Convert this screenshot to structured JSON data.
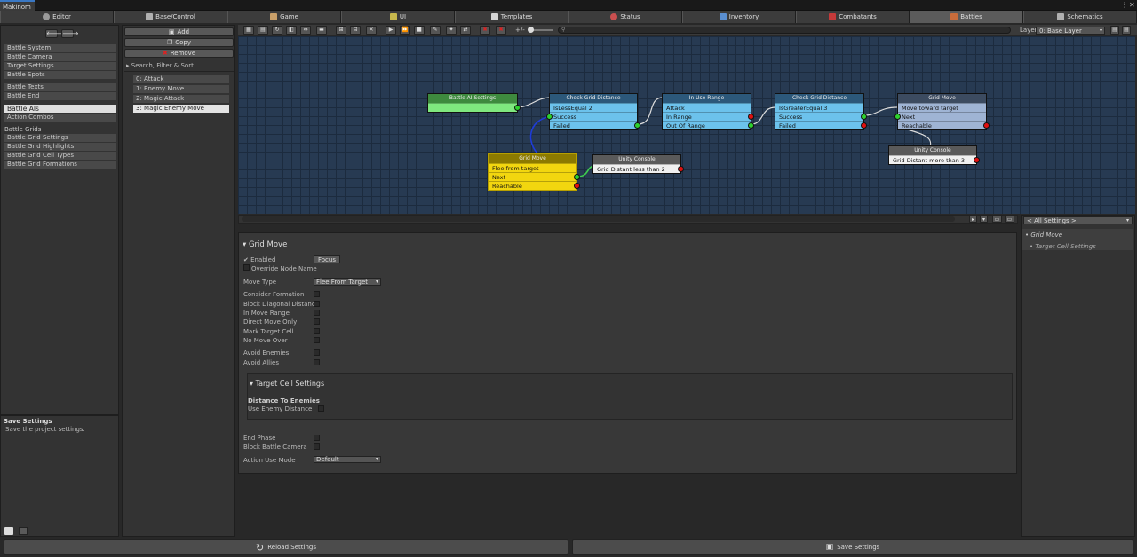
{
  "window": {
    "title": "Makinom"
  },
  "tabs": [
    {
      "label": "Editor",
      "icon": "gear-icon",
      "color": "#9a9a9a"
    },
    {
      "label": "Base/Control",
      "icon": "gamepad-icon",
      "color": "#b0b0b0"
    },
    {
      "label": "Game",
      "icon": "cube-icon",
      "color": "#c9a06a"
    },
    {
      "label": "UI",
      "icon": "ui-icon",
      "color": "#c7b84d"
    },
    {
      "label": "Templates",
      "icon": "document-icon",
      "color": "#d5d5d5"
    },
    {
      "label": "Status",
      "icon": "heart-icon",
      "color": "#c94f4f"
    },
    {
      "label": "Inventory",
      "icon": "potion-icon",
      "color": "#5a8fd1"
    },
    {
      "label": "Combatants",
      "icon": "character-icon",
      "color": "#c53a3a"
    },
    {
      "label": "Battles",
      "icon": "swords-icon",
      "color": "#c96c3b"
    },
    {
      "label": "Schematics",
      "icon": "node-icon",
      "color": "#b0b0b0"
    }
  ],
  "sidebar": {
    "items": [
      {
        "label": "Battle System"
      },
      {
        "label": "Battle Camera"
      },
      {
        "label": "Target Settings"
      },
      {
        "label": "Battle Spots"
      },
      {
        "label": "Battle Texts"
      },
      {
        "label": "Battle End"
      },
      {
        "label": "Battle AIs"
      },
      {
        "label": "Action Combos"
      },
      {
        "label": "Battle Grids"
      },
      {
        "label": "Battle Grid Settings"
      },
      {
        "label": "Battle Grid Highlights"
      },
      {
        "label": "Battle Grid Cell Types"
      },
      {
        "label": "Battle Grid Formations"
      }
    ],
    "help_title": "Save Settings",
    "help_text": "Save the project settings."
  },
  "list_panel": {
    "add": "Add",
    "copy": "Copy",
    "remove": "Remove",
    "search": "Search, Filter & Sort",
    "items": [
      "0: Attack",
      "1: Enemy Move",
      "2: Magic Attack",
      "3: Magic Enemy Move"
    ]
  },
  "toolbar": {
    "zoom": "+/-",
    "layer_label": "Layer",
    "layer_value": "0: Base Layer"
  },
  "nodes": {
    "n1": {
      "title": "Battle AI Settings"
    },
    "n2": {
      "title": "Check Grid Distance",
      "rows": [
        "IsLessEqual 2",
        "Success",
        "Failed"
      ]
    },
    "n3": {
      "title": "In Use Range",
      "rows": [
        "Attack",
        "In Range",
        "Out Of Range"
      ]
    },
    "n4": {
      "title": "Check Grid Distance",
      "rows": [
        "IsGreaterEqual 3",
        "Success",
        "Failed"
      ]
    },
    "n5": {
      "title": "Grid Move",
      "rows": [
        "Move toward target (Nearest)",
        "Next",
        "Reachable"
      ]
    },
    "n6": {
      "title": "Grid Move",
      "rows": [
        "Flee from target",
        "Next",
        "Reachable"
      ]
    },
    "n7": {
      "title": "Unity Console",
      "rows": [
        "Grid Distant less than 2"
      ]
    },
    "n8": {
      "title": "Unity Console",
      "rows": [
        "Grid Distant more than 3"
      ]
    }
  },
  "inspector": {
    "title": "Grid Move",
    "enabled": "Enabled",
    "focus": "Focus",
    "override": "Override Node Name",
    "move_type_label": "Move Type",
    "move_type_value": "Flee From Target",
    "options1": [
      "Consider Formation",
      "Block Diagonal Distance",
      "In Move Range",
      "Direct Move Only",
      "Mark Target Cell",
      "No Move Over"
    ],
    "options2": [
      "Avoid Enemies",
      "Avoid Allies"
    ],
    "target_title": "Target Cell Settings",
    "dist_header": "Distance To Enemies",
    "use_enemy": "Use Enemy Distance",
    "end_phase": "End Phase",
    "block_camera": "Block Battle Camera",
    "action_mode_label": "Action Use Mode",
    "action_mode_value": "Default"
  },
  "right_panel": {
    "filter": "< All Settings >",
    "item1": "Grid Move",
    "item2": "Target Cell Settings"
  },
  "footer": {
    "reload": "Reload Settings",
    "save": "Save Settings"
  }
}
